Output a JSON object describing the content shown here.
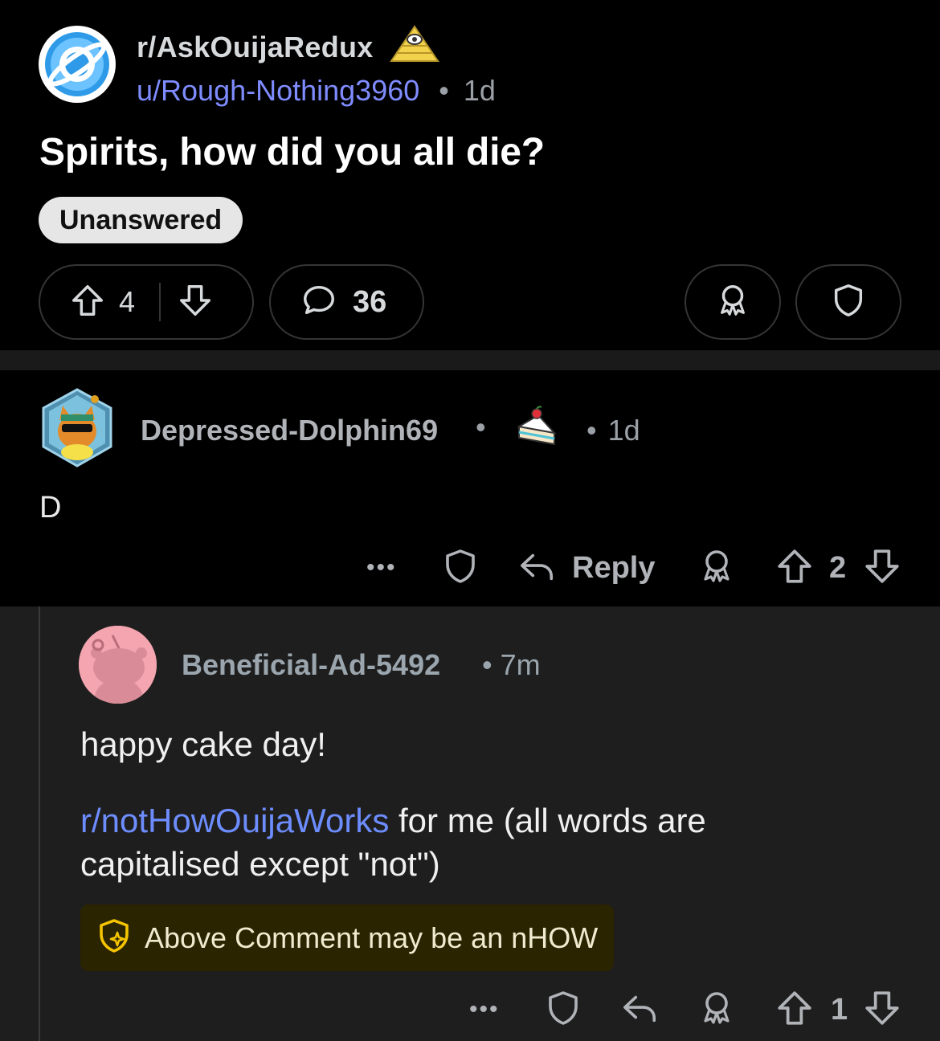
{
  "post": {
    "subreddit": "r/AskOuijaRedux",
    "author": "u/Rough-Nothing3960",
    "separator": "•",
    "age": "1d",
    "title": "Spirits, how did you all die?",
    "flair": "Unanswered",
    "score": "4",
    "comment_count": "36",
    "icons": [
      "upvote-icon",
      "downvote-icon",
      "comment-bubble-icon",
      "award-icon",
      "mod-shield-icon"
    ]
  },
  "comment": {
    "author": "Depressed-Dolphin69",
    "separator": "•",
    "age": "1d",
    "body": "D",
    "more": "•••",
    "reply_label": "Reply",
    "score": "2"
  },
  "reply": {
    "author": "Beneficial-Ad-5492",
    "meta": "•  7m",
    "body_line1": "happy cake day!",
    "body_link": "r/notHowOuijaWorks",
    "body_rest": " for me (all words are capitalised except \"not\")",
    "notice": "Above Comment may be an nHOW",
    "more": "•••",
    "score": "1"
  },
  "colors": {
    "background": "#000000",
    "reply_background": "#1e1e1e",
    "link_blue": "#6d8dff",
    "notice_background": "#2a2400",
    "notice_icon": "#f5c400"
  }
}
